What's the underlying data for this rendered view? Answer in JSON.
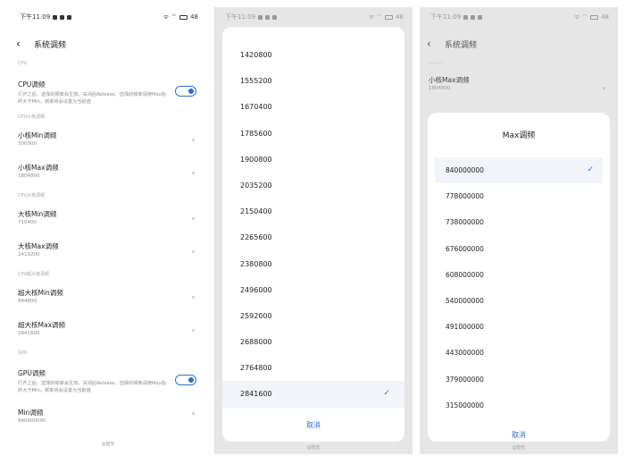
{
  "status": {
    "time": "下午11:09",
    "battery": "48",
    "net": "ᯤ ⌔"
  },
  "page": {
    "title": "系统调频",
    "back": "‹"
  },
  "screen1": {
    "cpu_section": "CPU",
    "cpu_toggle": {
      "title": "CPU调频",
      "desc": "打开之后，选择的频率会生效。关闭后Release，选择的频率请使Max始终大于Min，频率将会设置为当前值"
    },
    "small_section": "CPU小核调频",
    "small_min": {
      "title": "小核Min调频",
      "value": "300000"
    },
    "small_max": {
      "title": "小核Max调频",
      "value": "1804800"
    },
    "big_section": "CPU大核调频",
    "big_min": {
      "title": "大核Min调频",
      "value": "710400"
    },
    "big_max": {
      "title": "大核Max调频",
      "value": "2419200"
    },
    "super_section": "CPU超大核调频",
    "super_min": {
      "title": "超大核Min调频",
      "value": "844800"
    },
    "super_max": {
      "title": "超大核Max调频",
      "value": "2841600"
    },
    "gpu_section": "GPU",
    "gpu_toggle": {
      "title": "GPU调频",
      "desc": "打开之后，选择的频率会生效。关闭后Release，选择的频率请使Max始终大于Min，频率将会设置为当前值"
    },
    "gpu_min": {
      "title": "Min调频",
      "value": "840000000"
    },
    "watermark": "@酷安"
  },
  "screen2": {
    "options": [
      "1420800",
      "1555200",
      "1670400",
      "1785600",
      "1900800",
      "2035200",
      "2150400",
      "2265600",
      "2380800",
      "2496000",
      "2592000",
      "2688000",
      "2764800",
      "2841600"
    ],
    "selected": "2841600",
    "cancel": "取消",
    "watermark": "@酷安"
  },
  "screen3": {
    "label": "------",
    "row": {
      "title": "小核Max调频",
      "value": "1804800"
    },
    "dialog_title": "Max调频",
    "options": [
      "840000000",
      "778000000",
      "738000000",
      "676000000",
      "608000000",
      "540000000",
      "491000000",
      "443000000",
      "379000000",
      "315000000"
    ],
    "selected": "840000000",
    "cancel": "取消",
    "watermark": "@酷安"
  },
  "icons": {
    "back": "chevron-left-icon",
    "dropdown": "chevron-down-icon",
    "check": "checkmark-icon"
  },
  "colors": {
    "accent": "#2b6fd6"
  }
}
